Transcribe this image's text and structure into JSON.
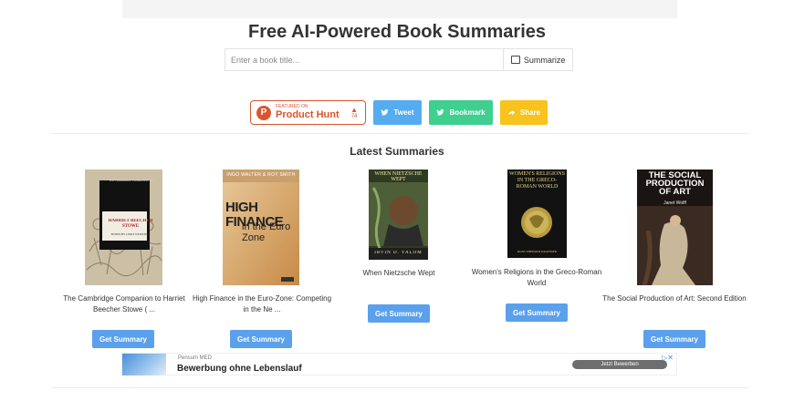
{
  "header": {
    "title": "Free AI-Powered Book Summaries"
  },
  "search": {
    "placeholder": "Enter a book title...",
    "value": "",
    "button_label": "Summarize"
  },
  "social": {
    "product_hunt_featured": "FEATURED ON",
    "product_hunt_name": "Product Hunt",
    "product_hunt_votes": "74",
    "tweet_label": "Tweet",
    "bookmark_label": "Bookmark",
    "share_label": "Share"
  },
  "latest": {
    "heading": "Latest Summaries",
    "books": [
      {
        "title": "The Cambridge Companion to Harriet Beecher Stowe ( ...",
        "button": "Get Summary",
        "cover_text_top": "THE CAMBRIDGE COMPANION TO",
        "cover_text_main": "HARRIET BEECHER STOWE",
        "cover_text_editor": "EDITED BY CINDY WEINSTEIN"
      },
      {
        "title": "High Finance in the Euro-Zone: Competing in the Ne ...",
        "button": "Get Summary",
        "cover_text_top": "INGO WALTER & ROY SMITH",
        "cover_text_main": "HIGH FINANCE",
        "cover_text_sub": "in the Euro Zone"
      },
      {
        "title": "When Nietzsche Wept",
        "button": "Get Summary",
        "cover_text_top": "WHEN NIETZSCHE WEPT",
        "cover_text_author": "IRVIN D. YALOM"
      },
      {
        "title": "Women's Religions in the Greco-Roman World",
        "button": "Get Summary",
        "cover_text_main": "WOMEN'S RELIGIONS IN THE GRECO-ROMAN WORLD",
        "cover_text_author": "ROSS SHEPARD KRAEMER"
      },
      {
        "title": "The Social Production of Art: Second Edition",
        "button": "Get Summary",
        "cover_text_main": "THE SOCIAL PRODUCTION OF ART",
        "cover_text_author": "Janet Wolff"
      }
    ]
  },
  "ad": {
    "advertiser": "Pensum MED",
    "headline": "Bewerbung ohne Lebenslauf",
    "cta": "Jetzt Bewerben"
  },
  "colors": {
    "product_hunt": "#da552f",
    "tweet": "#55acee",
    "bookmark": "#3fcf8e",
    "share": "#f8c31c",
    "get_summary": "#5aa0ec"
  }
}
